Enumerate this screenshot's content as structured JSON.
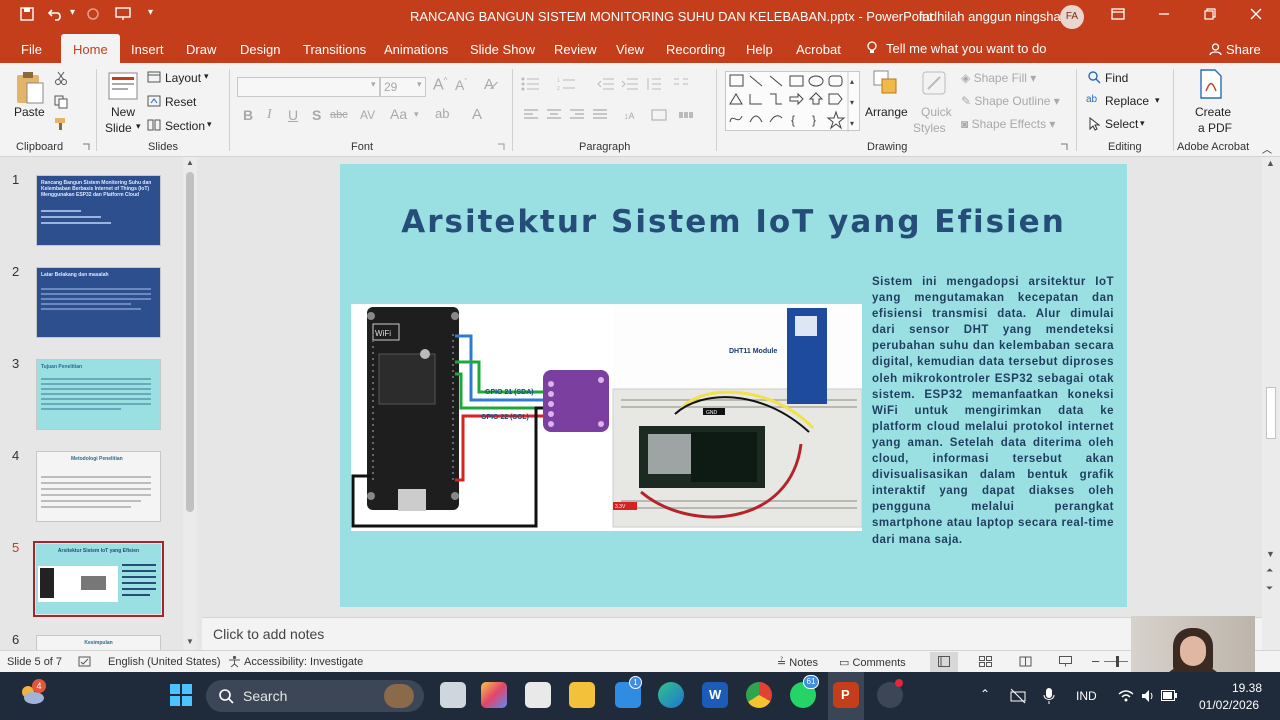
{
  "window": {
    "title": "RANCANG BANGUN SISTEM MONITORING SUHU DAN KELEBABAN.pptx  -  PowerPoint",
    "user": "fadhilah anggun ningsha",
    "avatar_initials": "FA"
  },
  "menu": {
    "tabs": [
      "File",
      "Home",
      "Insert",
      "Draw",
      "Design",
      "Transitions",
      "Animations",
      "Slide Show",
      "Review",
      "View",
      "Recording",
      "Help",
      "Acrobat"
    ],
    "active": "Home",
    "tell_me": "Tell me what you want to do",
    "share": "Share"
  },
  "ribbon": {
    "clipboard": {
      "label": "Clipboard",
      "paste": "Paste"
    },
    "slides": {
      "label": "Slides",
      "new_slide_1": "New",
      "new_slide_2": "Slide",
      "layout": "Layout",
      "reset": "Reset",
      "section": "Section"
    },
    "font": {
      "label": "Font",
      "font_size": "29"
    },
    "paragraph": {
      "label": "Paragraph"
    },
    "drawing": {
      "label": "Drawing",
      "arrange": "Arrange",
      "quick_styles_1": "Quick",
      "quick_styles_2": "Styles",
      "shape_fill": "Shape Fill",
      "shape_outline": "Shape Outline",
      "shape_effects": "Shape Effects"
    },
    "editing": {
      "label": "Editing",
      "find": "Find",
      "replace": "Replace",
      "select": "Select"
    },
    "acrobat": {
      "label": "Adobe Acrobat",
      "create_pdf_1": "Create",
      "create_pdf_2": "a PDF"
    }
  },
  "thumbnails": [
    {
      "num": "1",
      "title": "Rancang Bangun Sistem Monitoring Suhu dan Kelembaban Berbasis Internet of Things (IoT) Menggunakan ESP32 dan Platform Cloud"
    },
    {
      "num": "2",
      "title": "Latar Belakang dan masalah"
    },
    {
      "num": "3",
      "title": "Tujuan Penelitian"
    },
    {
      "num": "4",
      "title": "Metodologi Penelitian"
    },
    {
      "num": "5",
      "title": "Arsitektur Sistem IoT yang Efisien"
    },
    {
      "num": "6",
      "title": "Kesimpulan"
    }
  ],
  "slide": {
    "title": "Arsitektur Sistem IoT yang Efisien",
    "body": "Sistem ini mengadopsi arsitektur IoT yang mengutamakan kecepatan dan efisiensi transmisi data. Alur dimulai dari sensor DHT yang mendeteksi perubahan suhu dan kelembaban secara digital, kemudian data tersebut diproses oleh mikrokontroler ESP32 sebagai otak sistem. ESP32 memanfaatkan koneksi WiFi untuk mengirimkan data ke platform cloud melalui protokol internet yang aman. Setelah data diterima oleh cloud, informasi tersebut akan divisualisasikan dalam bentuk grafik interaktif yang dapat diakses oleh pengguna melalui perangkat smartphone atau laptop secara real-time dari mana saja.",
    "diagram_labels": {
      "gpio21": "GPIO 21 (SDA)",
      "gpio22": "GPIO 22 (SCL)",
      "dht11": "DHT11 Module",
      "gnd": "GND",
      "v33": "3.3V"
    }
  },
  "notes_placeholder": "Click to add notes",
  "status": {
    "slide_of": "Slide 5 of 7",
    "language": "English (United States)",
    "accessibility": "Accessibility: Investigate",
    "notes": "Notes",
    "comments": "Comments"
  },
  "taskbar": {
    "search": "Search",
    "language": "IND",
    "time": "19.38",
    "date": "01/02/2026",
    "badge_whatsapp": "61",
    "badge_tasks": "1"
  },
  "colors": {
    "accent": "#c43e1c",
    "slide_bg": "#9adfe2",
    "title_color": "#244e78"
  }
}
